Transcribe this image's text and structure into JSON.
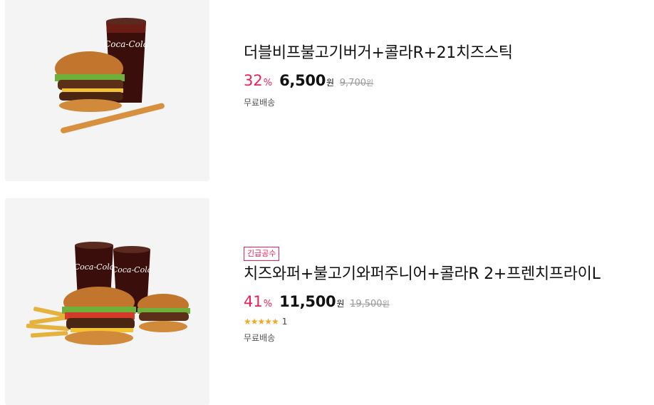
{
  "products": [
    {
      "title": "더블비프불고기버거+콜라R+21치즈스틱",
      "discount": "32",
      "discount_unit": "%",
      "price": "6,500",
      "price_unit": "원",
      "original_price": "9,700",
      "original_unit": "원",
      "shipping": "무료배송",
      "image_label": "Coca-Cola"
    },
    {
      "badge": "긴급공수",
      "title": "치즈와퍼+불고기와퍼주니어+콜라R 2+프렌치프라이L",
      "discount": "41",
      "discount_unit": "%",
      "price": "11,500",
      "price_unit": "원",
      "original_price": "19,500",
      "original_unit": "원",
      "stars": "★★★★★",
      "review_count": "1",
      "shipping": "무료배송",
      "image_label": "Coca-Cola"
    }
  ],
  "colors": {
    "accent": "#ed1f55",
    "star": "#f5a623",
    "thumb_bg": "#f4f4f4"
  }
}
